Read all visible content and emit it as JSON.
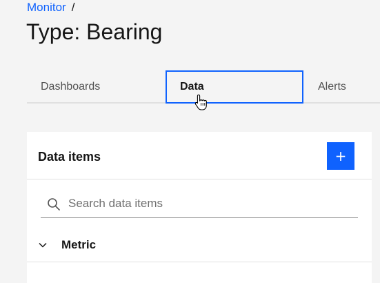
{
  "breadcrumb": {
    "items": [
      {
        "label": "Monitor"
      }
    ],
    "separator": "/"
  },
  "page": {
    "title": "Type: Bearing"
  },
  "tabs": [
    {
      "label": "Dashboards",
      "selected": false
    },
    {
      "label": "Data",
      "selected": true
    },
    {
      "label": "Alerts",
      "selected": false
    }
  ],
  "data_items_panel": {
    "title": "Data items",
    "add_label": "+",
    "search": {
      "placeholder": "Search data items",
      "value": ""
    },
    "groups": [
      {
        "label": "Metric",
        "expanded": true
      }
    ]
  },
  "colors": {
    "accent": "#0f62fe",
    "background": "#f4f4f4",
    "panel": "#ffffff",
    "text": "#161616"
  },
  "icons": {
    "search": "search-icon",
    "chevron": "chevron-down-icon",
    "cursor": "hand-pointer-icon"
  }
}
